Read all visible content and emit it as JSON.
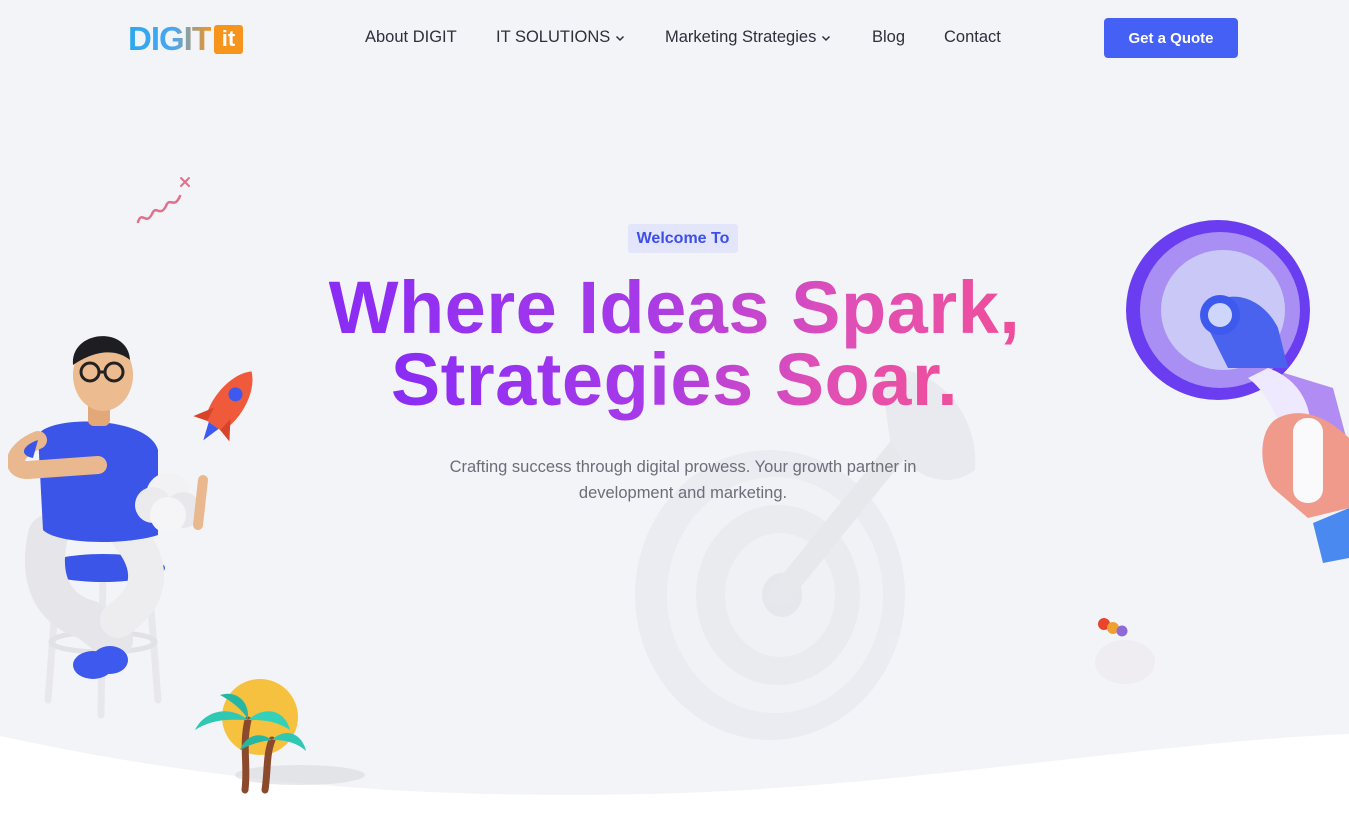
{
  "logo": {
    "wordmark": "DIGIT",
    "badge": "it"
  },
  "nav": {
    "items": [
      {
        "label": "About DIGIT",
        "has_dropdown": false
      },
      {
        "label": "IT SOLUTIONS",
        "has_dropdown": true
      },
      {
        "label": "Marketing Strategies",
        "has_dropdown": true
      },
      {
        "label": "Blog",
        "has_dropdown": false
      },
      {
        "label": "Contact",
        "has_dropdown": false
      }
    ],
    "cta_label": "Get a Quote"
  },
  "hero": {
    "badge": "Welcome To",
    "headline_line1": "Where Ideas Spark,",
    "headline_line2": "Strategies Soar.",
    "subtitle_line1": "Crafting success through digital prowess. Your growth partner in",
    "subtitle_line2": "development and marketing."
  },
  "colors": {
    "accent": "#4560f5",
    "badge_text": "#3e4ee8",
    "headline_gradient_start": "#8a2cf5",
    "headline_gradient_end": "#ef4f9a",
    "logo_orange": "#f7941d",
    "logo_blue": "#2aa8f0"
  },
  "illustrations": [
    "person-on-stool-illustration",
    "rocket-icon",
    "megaphone-illustration",
    "target-dart-illustration",
    "palm-trees-sun-illustration",
    "squiggle-decoration"
  ]
}
